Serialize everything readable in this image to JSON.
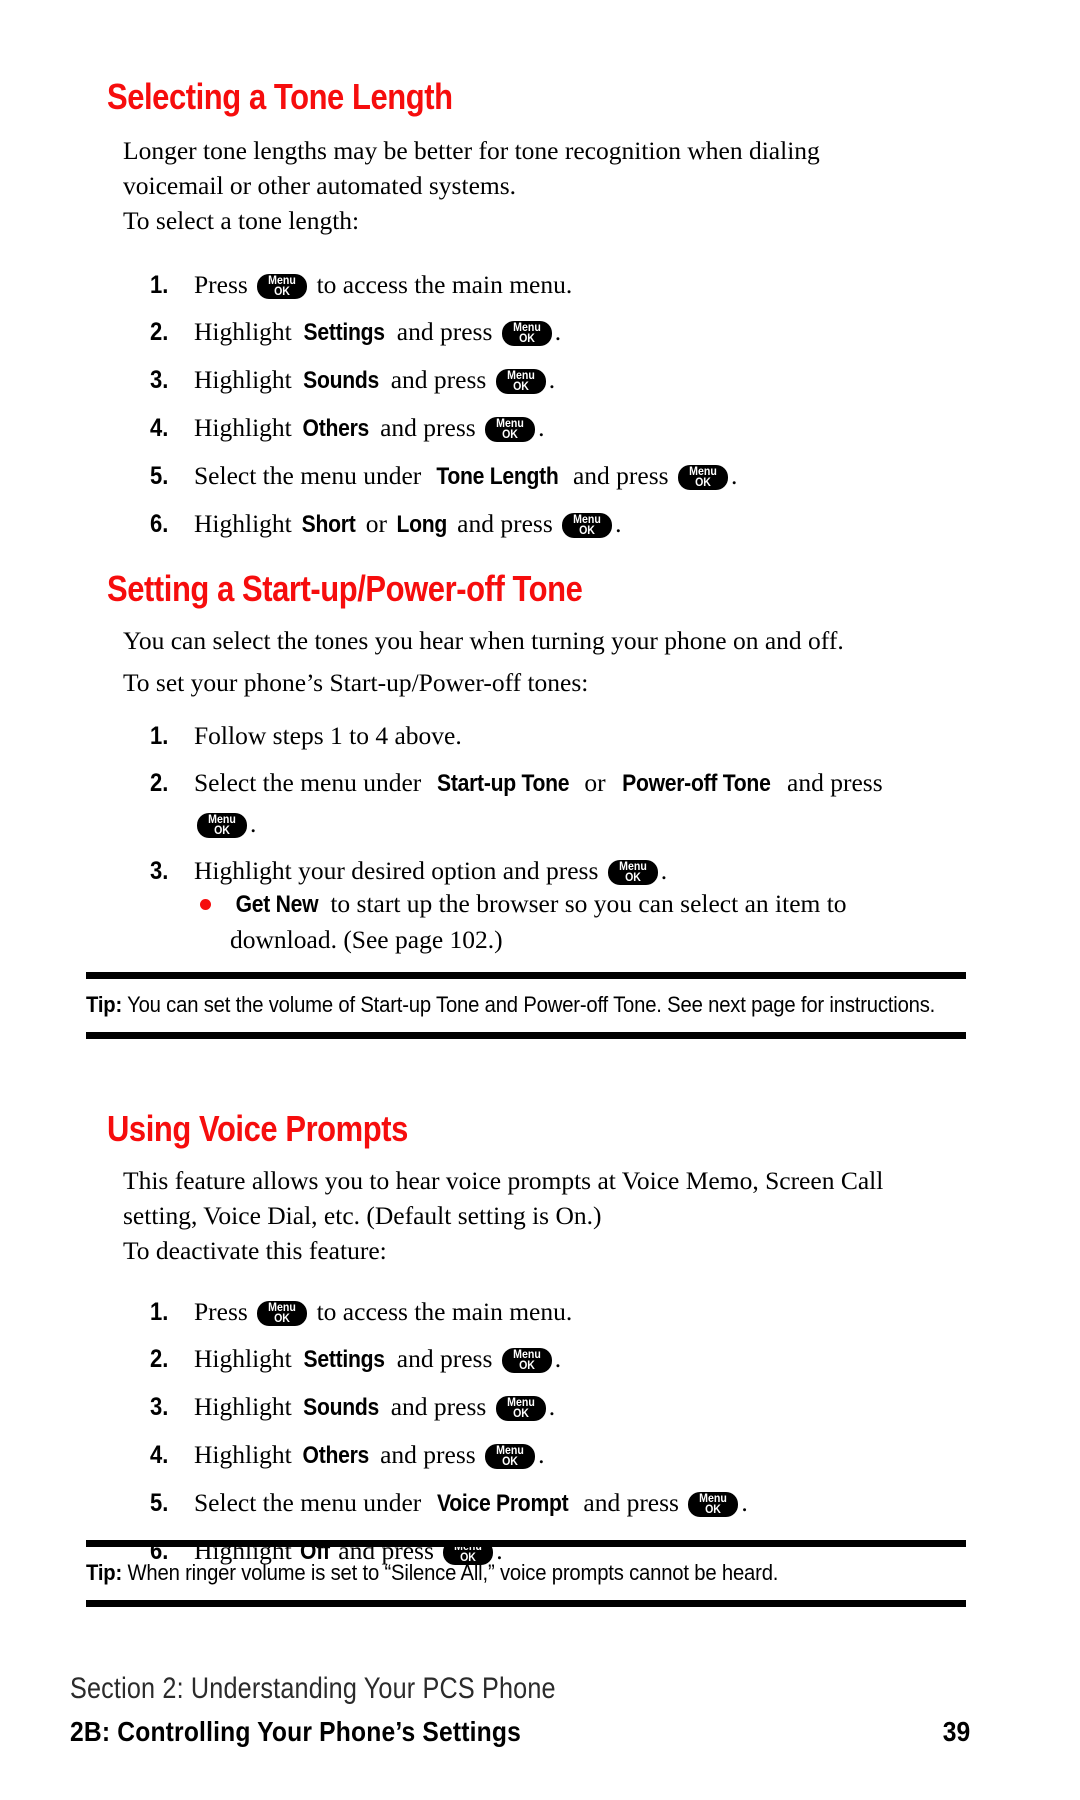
{
  "key_icon": {
    "line1": "Menu",
    "line2": "OK",
    "name": "menu-ok-key"
  },
  "colors": {
    "heading_red": "#f60d0d",
    "bullet_red": "#f60d0d",
    "text_black": "#000000"
  },
  "sections": [
    {
      "heading": "Selecting a Tone Length",
      "intro": "Longer tone lengths may be better for tone recognition when dialing voicemail or other automated systems.",
      "lead_in": "To select a tone length:",
      "steps": [
        {
          "num": "1.",
          "parts": [
            {
              "t": "text",
              "v": "Press "
            },
            {
              "t": "key"
            },
            {
              "t": "text",
              "v": " to access the main menu."
            }
          ]
        },
        {
          "num": "2.",
          "parts": [
            {
              "t": "text",
              "v": "Highlight "
            },
            {
              "t": "ui",
              "v": "Settings"
            },
            {
              "t": "text",
              "v": " and press "
            },
            {
              "t": "key"
            },
            {
              "t": "text",
              "v": "."
            }
          ]
        },
        {
          "num": "3.",
          "parts": [
            {
              "t": "text",
              "v": "Highlight "
            },
            {
              "t": "ui",
              "v": "Sounds"
            },
            {
              "t": "text",
              "v": " and press "
            },
            {
              "t": "key"
            },
            {
              "t": "text",
              "v": "."
            }
          ]
        },
        {
          "num": "4.",
          "parts": [
            {
              "t": "text",
              "v": "Highlight "
            },
            {
              "t": "ui",
              "v": "Others"
            },
            {
              "t": "text",
              "v": " and press "
            },
            {
              "t": "key"
            },
            {
              "t": "text",
              "v": "."
            }
          ]
        },
        {
          "num": "5.",
          "parts": [
            {
              "t": "text",
              "v": "Select the menu under "
            },
            {
              "t": "ui",
              "v": "Tone Length"
            },
            {
              "t": "text",
              "v": " and press "
            },
            {
              "t": "key"
            },
            {
              "t": "text",
              "v": "."
            }
          ]
        },
        {
          "num": "6.",
          "parts": [
            {
              "t": "text",
              "v": "Highlight "
            },
            {
              "t": "ui",
              "v": "Short"
            },
            {
              "t": "text",
              "v": " or "
            },
            {
              "t": "ui",
              "v": "Long"
            },
            {
              "t": "text",
              "v": " and press "
            },
            {
              "t": "key"
            },
            {
              "t": "text",
              "v": "."
            }
          ]
        }
      ]
    },
    {
      "heading": "Setting a Start-up/Power-off Tone",
      "intro": "You can select the tones you hear when turning your phone on and off.",
      "lead_in": "To set your phone’s Start-up/Power-off tones:",
      "steps": [
        {
          "num": "1.",
          "parts": [
            {
              "t": "text",
              "v": "Follow steps 1 to 4 above."
            }
          ]
        },
        {
          "num": "2.",
          "parts": [
            {
              "t": "text",
              "v": "Select the menu under "
            },
            {
              "t": "ui",
              "v": "Start-up Tone"
            },
            {
              "t": "text",
              "v": " or "
            },
            {
              "t": "ui",
              "v": "Power-off Tone"
            },
            {
              "t": "text",
              "v": " and press "
            },
            {
              "t": "key"
            },
            {
              "t": "text",
              "v": "."
            }
          ]
        },
        {
          "num": "3.",
          "parts": [
            {
              "t": "text",
              "v": "Highlight your desired option and press "
            },
            {
              "t": "key"
            },
            {
              "t": "text",
              "v": "."
            }
          ]
        }
      ],
      "bullets": [
        {
          "parts": [
            {
              "t": "ui",
              "v": "Get New"
            },
            {
              "t": "text",
              "v": " to start up the browser so you can select an item to download. (See page 102.)"
            }
          ]
        }
      ]
    },
    {
      "heading": "Using Voice Prompts",
      "intro": "This feature allows you to hear voice prompts at Voice Memo, Screen Call setting, Voice Dial, etc. (Default setting is On.)",
      "lead_in": "To deactivate this feature:",
      "steps": [
        {
          "num": "1.",
          "parts": [
            {
              "t": "text",
              "v": "Press "
            },
            {
              "t": "key"
            },
            {
              "t": "text",
              "v": " to access the main menu."
            }
          ]
        },
        {
          "num": "2.",
          "parts": [
            {
              "t": "text",
              "v": "Highlight "
            },
            {
              "t": "ui",
              "v": "Settings"
            },
            {
              "t": "text",
              "v": " and press "
            },
            {
              "t": "key"
            },
            {
              "t": "text",
              "v": "."
            }
          ]
        },
        {
          "num": "3.",
          "parts": [
            {
              "t": "text",
              "v": "Highlight "
            },
            {
              "t": "ui",
              "v": "Sounds"
            },
            {
              "t": "text",
              "v": " and press "
            },
            {
              "t": "key"
            },
            {
              "t": "text",
              "v": "."
            }
          ]
        },
        {
          "num": "4.",
          "parts": [
            {
              "t": "text",
              "v": "Highlight "
            },
            {
              "t": "ui",
              "v": "Others"
            },
            {
              "t": "text",
              "v": " and press "
            },
            {
              "t": "key"
            },
            {
              "t": "text",
              "v": "."
            }
          ]
        },
        {
          "num": "5.",
          "parts": [
            {
              "t": "text",
              "v": "Select the menu under "
            },
            {
              "t": "ui",
              "v": "Voice Prompt"
            },
            {
              "t": "text",
              "v": " and press "
            },
            {
              "t": "key"
            },
            {
              "t": "text",
              "v": "."
            }
          ]
        },
        {
          "num": "6.",
          "parts": [
            {
              "t": "text",
              "v": "Highlight "
            },
            {
              "t": "ui",
              "v": "Off"
            },
            {
              "t": "text",
              "v": " and press "
            },
            {
              "t": "key"
            },
            {
              "t": "text",
              "v": "."
            }
          ]
        }
      ]
    }
  ],
  "tips": [
    {
      "label": "Tip:",
      "text": " You can set the volume of Start-up Tone and Power-off Tone. See next page for instructions."
    },
    {
      "label": "Tip:",
      "text": " When ringer volume is set to “Silence All,” voice prompts cannot be heard."
    }
  ],
  "footer": {
    "section_line": "Section 2: Understanding Your PCS Phone",
    "chapter_line": "2B: Controlling Your Phone’s Settings",
    "page_number": "39"
  }
}
